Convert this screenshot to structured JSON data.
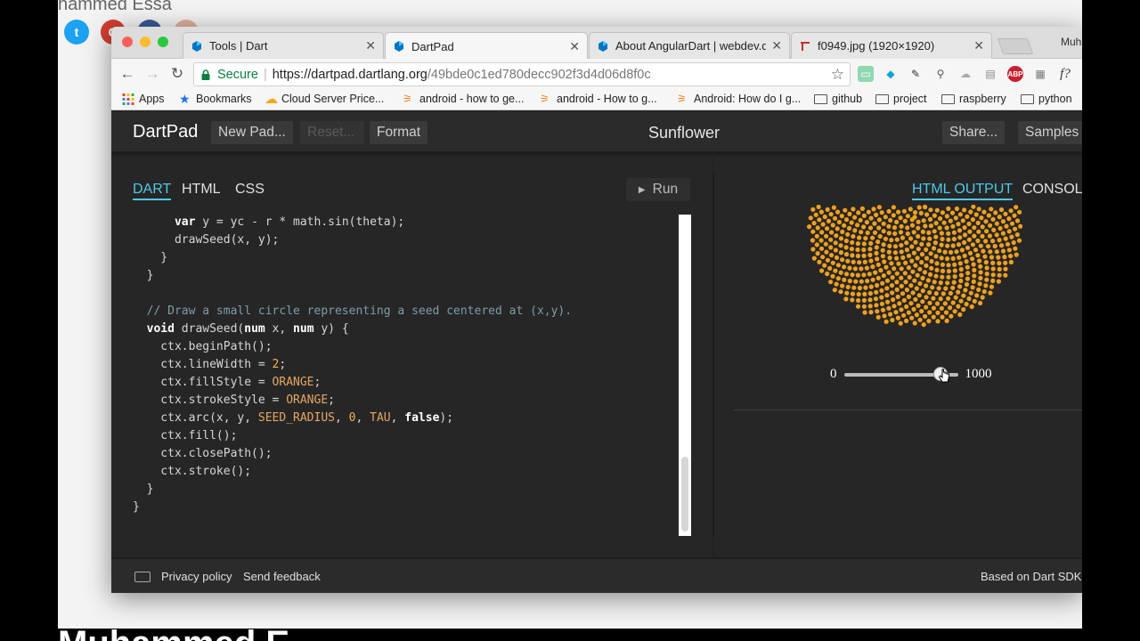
{
  "background": {
    "partial_name": "hammed Essa",
    "bottom_partial_text": "Muhammed E"
  },
  "browser": {
    "profile_name": "Muh",
    "tabs": [
      {
        "title": "Tools | Dart",
        "active": false
      },
      {
        "title": "DartPad",
        "active": true
      },
      {
        "title": "About AngularDart | webdev.dart",
        "active": false
      },
      {
        "title": "f0949.jpg (1920×1920)",
        "active": false
      }
    ],
    "address": {
      "secure_label": "Secure",
      "url_host": "https://dartpad.dartlang.org",
      "url_path": "/49bde0c1ed780decc902f3d4d06d8f0c"
    },
    "bookmarks": [
      {
        "label": "Apps",
        "icon": "apps-grid-icon"
      },
      {
        "label": "Bookmarks",
        "icon": "star-icon"
      },
      {
        "label": "Cloud Server Price...",
        "icon": "cloud-icon"
      },
      {
        "label": "android - how to ge...",
        "icon": "stackoverflow-icon"
      },
      {
        "label": "android - How to g...",
        "icon": "stackoverflow-icon"
      },
      {
        "label": "Android: How do I g...",
        "icon": "stackoverflow-icon"
      },
      {
        "label": "github",
        "icon": "folder-icon"
      },
      {
        "label": "project",
        "icon": "folder-icon"
      },
      {
        "label": "raspberry",
        "icon": "folder-icon"
      },
      {
        "label": "python",
        "icon": "folder-icon"
      }
    ]
  },
  "dartpad": {
    "logo": "DartPad",
    "buttons": {
      "new_pad": "New Pad...",
      "reset": "Reset...",
      "format": "Format",
      "share": "Share...",
      "samples": "Samples"
    },
    "pad_title": "Sunflower",
    "editor_tabs": [
      "DART",
      "HTML",
      "CSS"
    ],
    "run_label": "Run",
    "output_tabs": [
      "HTML OUTPUT",
      "CONSOLE"
    ],
    "slider": {
      "min": "0",
      "max": "1000",
      "value": 0.85
    },
    "footer": {
      "privacy": "Privacy policy",
      "feedback": "Send feedback",
      "sdk": "Based on Dart SDK"
    }
  },
  "code_lines": [
    [
      {
        "t": "      "
      },
      {
        "t": "var",
        "c": "kw"
      },
      {
        "t": " y = yc - r * math.sin(theta);"
      }
    ],
    [
      {
        "t": "      drawSeed(x, y);"
      }
    ],
    [
      {
        "t": "    }"
      }
    ],
    [
      {
        "t": "  }"
      }
    ],
    [
      {
        "t": ""
      }
    ],
    [
      {
        "t": "  // Draw a small circle representing a seed centered at (x,y).",
        "c": "cm"
      }
    ],
    [
      {
        "t": "  "
      },
      {
        "t": "void",
        "c": "kw"
      },
      {
        "t": " drawSeed("
      },
      {
        "t": "num",
        "c": "kw"
      },
      {
        "t": " x, "
      },
      {
        "t": "num",
        "c": "kw"
      },
      {
        "t": " y) {"
      }
    ],
    [
      {
        "t": "    ctx.beginPath();"
      }
    ],
    [
      {
        "t": "    ctx.lineWidth = "
      },
      {
        "t": "2",
        "c": "num"
      },
      {
        "t": ";"
      }
    ],
    [
      {
        "t": "    ctx.fillStyle = "
      },
      {
        "t": "ORANGE",
        "c": "ct"
      },
      {
        "t": ";"
      }
    ],
    [
      {
        "t": "    ctx.strokeStyle = "
      },
      {
        "t": "ORANGE",
        "c": "ct"
      },
      {
        "t": ";"
      }
    ],
    [
      {
        "t": "    ctx.arc(x, y, "
      },
      {
        "t": "SEED_RADIUS",
        "c": "ct"
      },
      {
        "t": ", "
      },
      {
        "t": "0",
        "c": "num"
      },
      {
        "t": ", "
      },
      {
        "t": "TAU",
        "c": "ct"
      },
      {
        "t": ", "
      },
      {
        "t": "false",
        "c": "kw"
      },
      {
        "t": ");"
      }
    ],
    [
      {
        "t": "    ctx.fill();"
      }
    ],
    [
      {
        "t": "    ctx.closePath();"
      }
    ],
    [
      {
        "t": "    ctx.stroke();"
      }
    ],
    [
      {
        "t": "  }"
      }
    ],
    [
      {
        "t": "}"
      }
    ]
  ],
  "colors": {
    "accent": "#4ec9e9",
    "seed": "#f0a020",
    "secure_green": "#0b8043"
  }
}
